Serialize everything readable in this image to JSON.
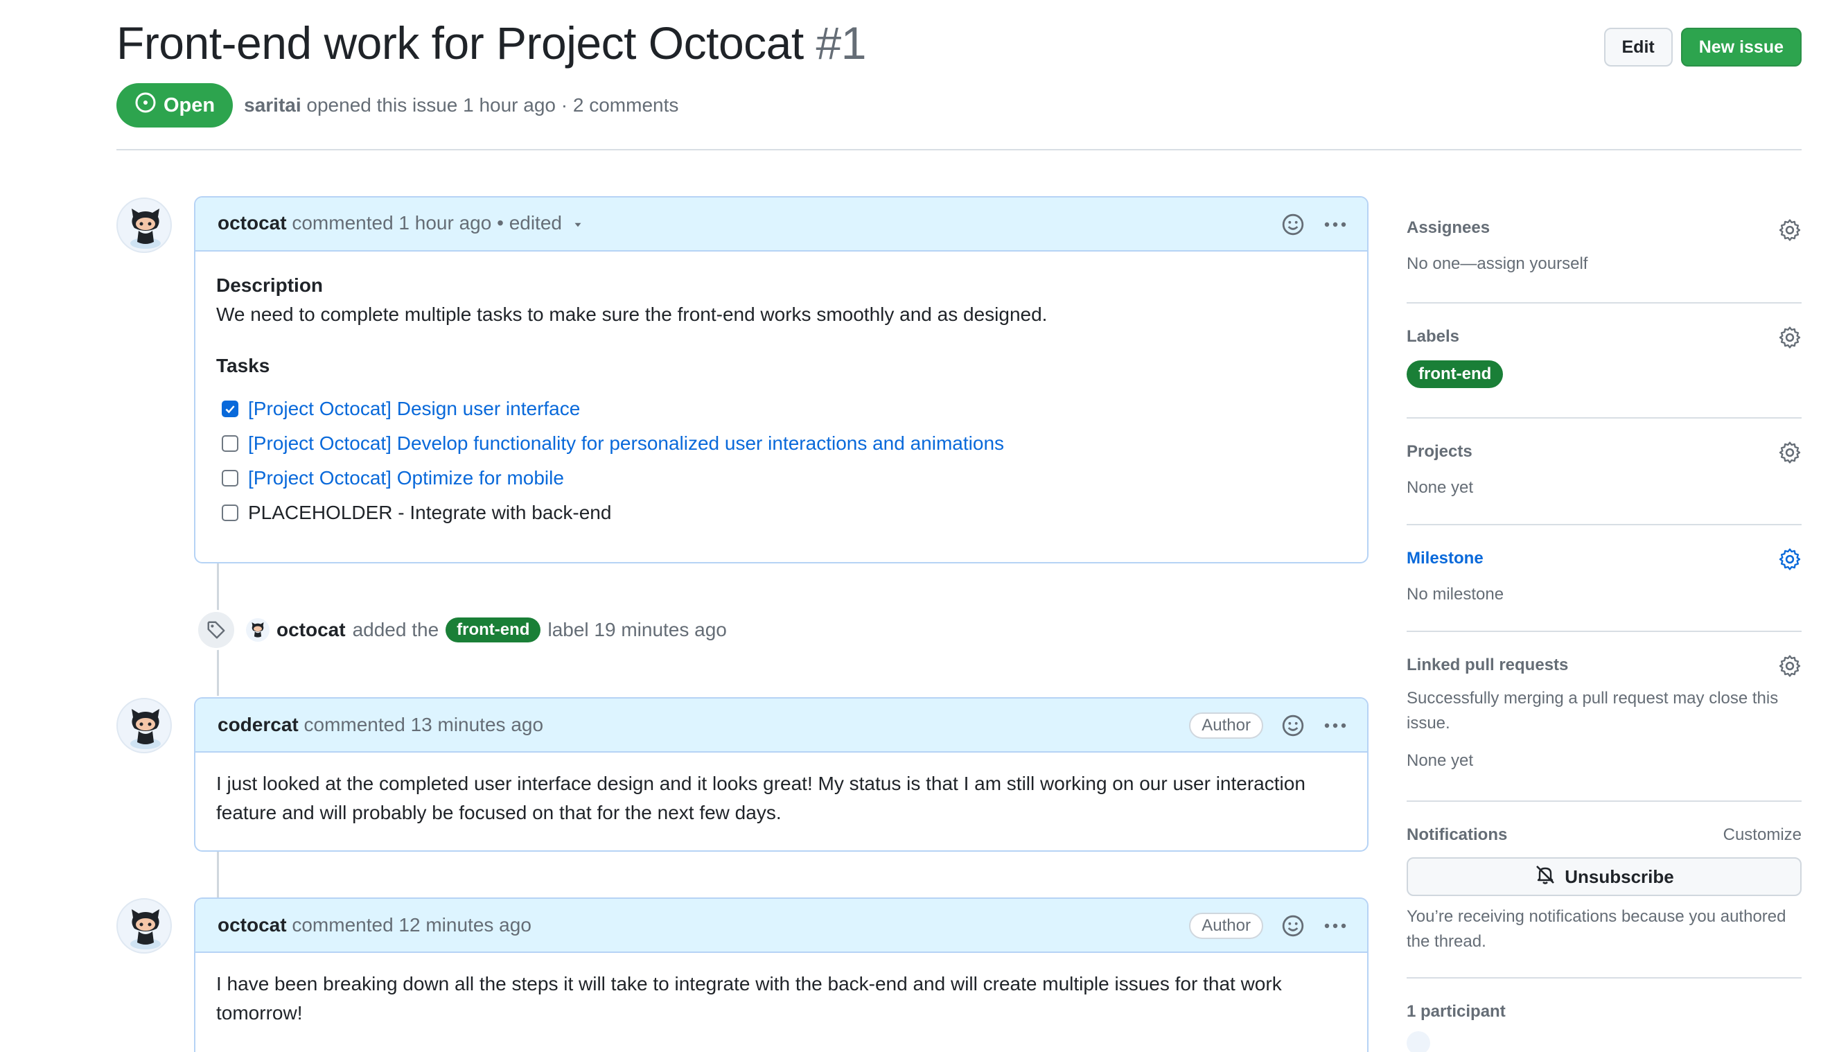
{
  "issue": {
    "title": "Front-end work for Project Octocat",
    "number": "#1",
    "state": "Open",
    "author": "saritai",
    "meta_text": "opened this issue 1 hour ago · 2 comments"
  },
  "header_buttons": {
    "edit": "Edit",
    "new_issue": "New issue"
  },
  "comments": [
    {
      "author": "octocat",
      "action": "commented 1 hour ago",
      "edited": "• edited",
      "description_heading": "Description",
      "description_text": "We need to complete multiple tasks to make sure the front-end works smoothly and as designed.",
      "tasks_heading": "Tasks",
      "tasks": [
        {
          "label": "[Project Octocat] Design user interface",
          "checked": true,
          "link": true
        },
        {
          "label": "[Project Octocat] Develop functionality for personalized user interactions and animations",
          "checked": false,
          "link": true
        },
        {
          "label": "[Project Octocat] Optimize for mobile",
          "checked": false,
          "link": true
        },
        {
          "label": "PLACEHOLDER - Integrate with back-end",
          "checked": false,
          "link": false
        }
      ]
    },
    {
      "author": "codercat",
      "action": "commented 13 minutes ago",
      "badge": "Author",
      "body": "I just looked at the completed user interface design and it looks great! My status is that I am still working on our user interaction feature and will probably be focused on that for the next few days."
    },
    {
      "author": "octocat",
      "action": "commented 12 minutes ago",
      "badge": "Author",
      "body": "I have been breaking down all the steps it will take to integrate with the back-end and will create multiple issues for that work tomorrow!"
    }
  ],
  "event": {
    "actor": "octocat",
    "pre": "added the",
    "label": "front-end",
    "post": "label 19 minutes ago"
  },
  "sidebar": {
    "assignees": {
      "title": "Assignees",
      "value": "No one—assign yourself"
    },
    "labels": {
      "title": "Labels",
      "value": "front-end"
    },
    "projects": {
      "title": "Projects",
      "value": "None yet"
    },
    "milestone": {
      "title": "Milestone",
      "value": "No milestone"
    },
    "linked_prs": {
      "title": "Linked pull requests",
      "help": "Successfully merging a pull request may close this issue.",
      "value": "None yet"
    },
    "notifications": {
      "title": "Notifications",
      "customize": "Customize",
      "button": "Unsubscribe",
      "reason": "You’re receiving notifications because you authored the thread."
    },
    "participants": {
      "title": "1 participant"
    }
  },
  "colors": {
    "accent": "#0969da",
    "open_green": "#2da44e",
    "label_green": "#1a7f37",
    "comment_header": "#ddf4ff"
  },
  "icons": [
    "issue-opened-icon",
    "triangle-down-icon",
    "smiley-icon",
    "kebab-horizontal-icon",
    "tag-icon",
    "gear-icon",
    "bell-slash-icon",
    "check-icon"
  ]
}
